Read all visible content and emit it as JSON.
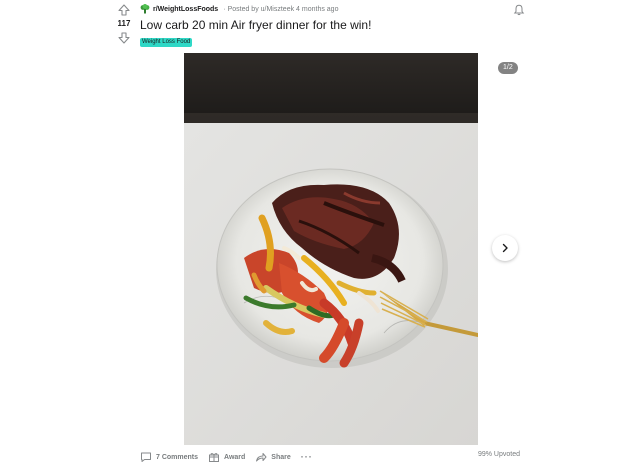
{
  "post": {
    "subreddit": "r/WeightLossFoods",
    "posted_by": "Posted by u/Miszteek",
    "time_ago": "4 months ago",
    "separator": "·",
    "title": "Low carb 20 min Air fryer dinner for the win!",
    "flair": "Weight Loss Food",
    "score": "117",
    "flair_color": "#2fd8c6"
  },
  "media": {
    "counter": "1/2"
  },
  "actions": {
    "comments_label": "7 Comments",
    "award_label": "Award",
    "share_label": "Share",
    "more_label": "···",
    "upvoted_text": "99% Upvoted"
  },
  "icons": {
    "upvote": "arrow-up-icon",
    "downvote": "arrow-down-icon",
    "subreddit": "broccoli-icon",
    "bell": "bell-icon",
    "next": "chevron-right-icon",
    "comment": "comment-icon",
    "award": "gift-icon",
    "share": "share-arrow-icon"
  }
}
